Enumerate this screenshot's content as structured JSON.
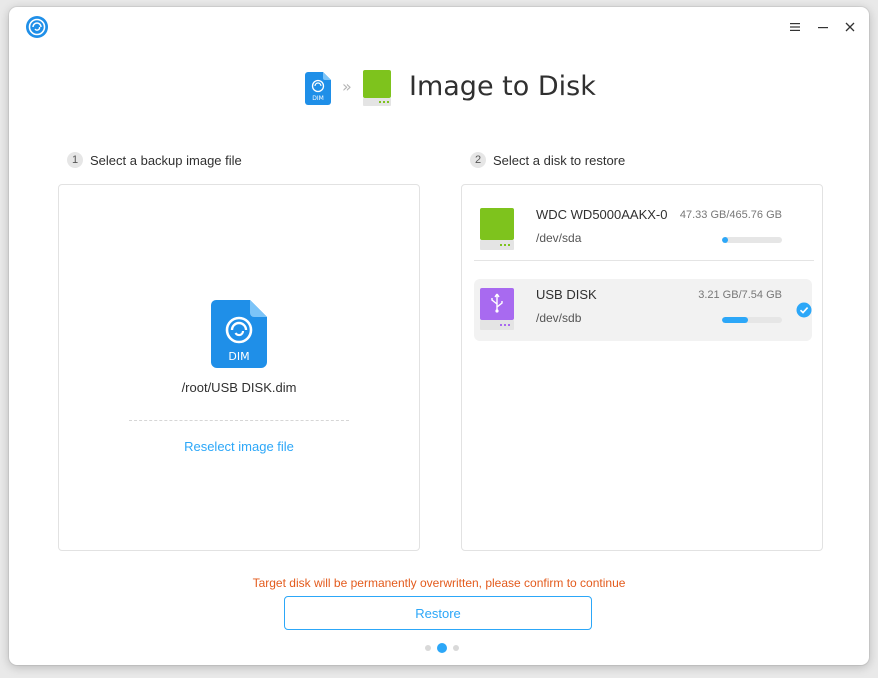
{
  "window": {
    "title": "Image to Disk",
    "controls": [
      "menu-icon",
      "minimize-icon",
      "close-icon"
    ]
  },
  "steps": {
    "left": {
      "number": "1",
      "label": "Select a backup image file"
    },
    "right": {
      "number": "2",
      "label": "Select a disk to restore"
    }
  },
  "image_file": {
    "icon_label": "DIM",
    "path": "/root/USB DISK.dim",
    "reselect_label": "Reselect image file"
  },
  "disks": [
    {
      "name": "WDC WD5000AAKX-0",
      "device": "/dev/sda",
      "size": "47.33 GB/465.76 GB",
      "usage": 0.1,
      "color": "#7ec31d",
      "type": "hdd",
      "selected": false
    },
    {
      "name": "USB DISK",
      "device": "/dev/sdb",
      "size": "3.21 GB/7.54 GB",
      "usage": 0.43,
      "color": "#a86af0",
      "type": "usb",
      "selected": true
    }
  ],
  "footer": {
    "warning": "Target disk will be permanently overwritten, please confirm to continue",
    "restore_label": "Restore",
    "page_indicator": {
      "count": 3,
      "active": 2
    }
  },
  "colors": {
    "accent": "#2ca7f8",
    "warning": "#e35b1d"
  }
}
